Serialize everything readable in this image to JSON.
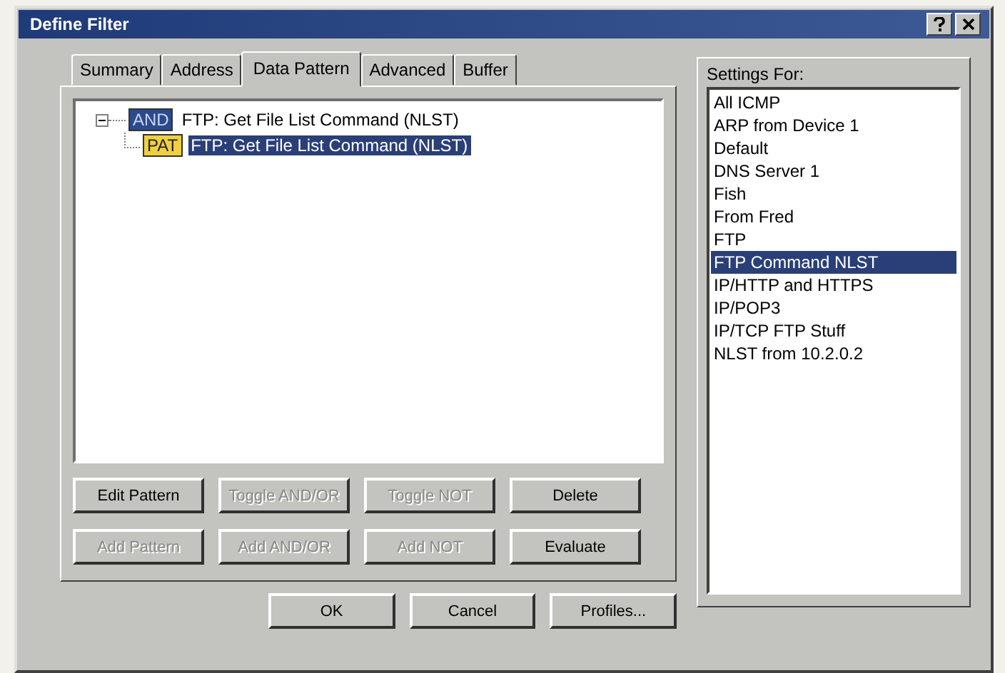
{
  "window": {
    "title": "Define Filter"
  },
  "tabs": [
    {
      "label": "Summary",
      "selected": false
    },
    {
      "label": "Address",
      "selected": false
    },
    {
      "label": "Data Pattern",
      "selected": true
    },
    {
      "label": "Advanced",
      "selected": false
    },
    {
      "label": "Buffer",
      "selected": false
    }
  ],
  "tree": [
    {
      "kind": "and",
      "tag": "AND",
      "label": "FTP: Get File List Command (NLST)",
      "expanded": true,
      "selected": false,
      "children": [
        {
          "kind": "pattern",
          "tag": "PAT",
          "label": "FTP: Get File List Command (NLST)",
          "selected": true
        }
      ]
    }
  ],
  "pattern_buttons": [
    {
      "label": "Edit Pattern",
      "disabled": false
    },
    {
      "label": "Toggle AND/OR",
      "disabled": true
    },
    {
      "label": "Toggle NOT",
      "disabled": true
    },
    {
      "label": "Delete",
      "disabled": false
    },
    {
      "label": "Add Pattern",
      "disabled": true
    },
    {
      "label": "Add AND/OR",
      "disabled": true
    },
    {
      "label": "Add NOT",
      "disabled": true
    },
    {
      "label": "Evaluate",
      "disabled": false
    }
  ],
  "settings": {
    "label": "Settings For:",
    "items": [
      {
        "label": "All ICMP",
        "selected": false
      },
      {
        "label": "ARP from Device 1",
        "selected": false
      },
      {
        "label": "Default",
        "selected": false
      },
      {
        "label": "DNS Server 1",
        "selected": false
      },
      {
        "label": "Fish",
        "selected": false
      },
      {
        "label": "From Fred",
        "selected": false
      },
      {
        "label": "FTP",
        "selected": false
      },
      {
        "label": "FTP Command NLST",
        "selected": true
      },
      {
        "label": "IP/HTTP and HTTPS",
        "selected": false
      },
      {
        "label": "IP/POP3",
        "selected": false
      },
      {
        "label": "IP/TCP FTP Stuff",
        "selected": false
      },
      {
        "label": "NLST from 10.2.0.2",
        "selected": false
      }
    ]
  },
  "buttons": [
    {
      "label": "OK"
    },
    {
      "label": "Cancel"
    },
    {
      "label": "Profiles..."
    }
  ]
}
